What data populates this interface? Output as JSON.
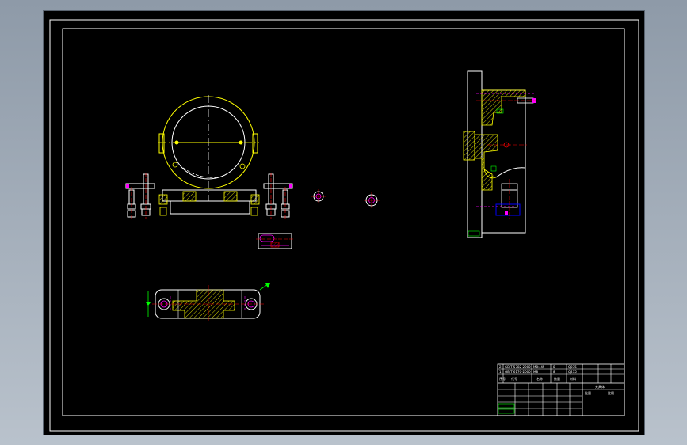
{
  "drawing": {
    "colors": {
      "background": "#000000",
      "frame": "#ffffff",
      "outline": "#ffffff",
      "centerline_yellow": "#ffff00",
      "centerline_red": "#ff0000",
      "hidden": "#ff00ff",
      "hatch": "#ffff00",
      "dimension": "#00ff00",
      "blue": "#0000ff"
    },
    "views": [
      {
        "name": "front-view"
      },
      {
        "name": "side-section-view"
      },
      {
        "name": "bottom-plan-view"
      },
      {
        "name": "pin-detail"
      },
      {
        "name": "nut-detail-a"
      },
      {
        "name": "nut-detail-b"
      }
    ]
  },
  "title_block": {
    "rows": [
      [
        "2",
        "GB/T 5782-2000",
        "M8×45",
        "8",
        "Q235"
      ],
      [
        "1",
        "GB/T 6170-2000",
        "M8",
        "8",
        "Q235"
      ]
    ],
    "headers": [
      "序号",
      "代号",
      "名称",
      "数量",
      "材料"
    ],
    "labels": [
      "夹具体",
      "批量",
      "比例"
    ]
  }
}
